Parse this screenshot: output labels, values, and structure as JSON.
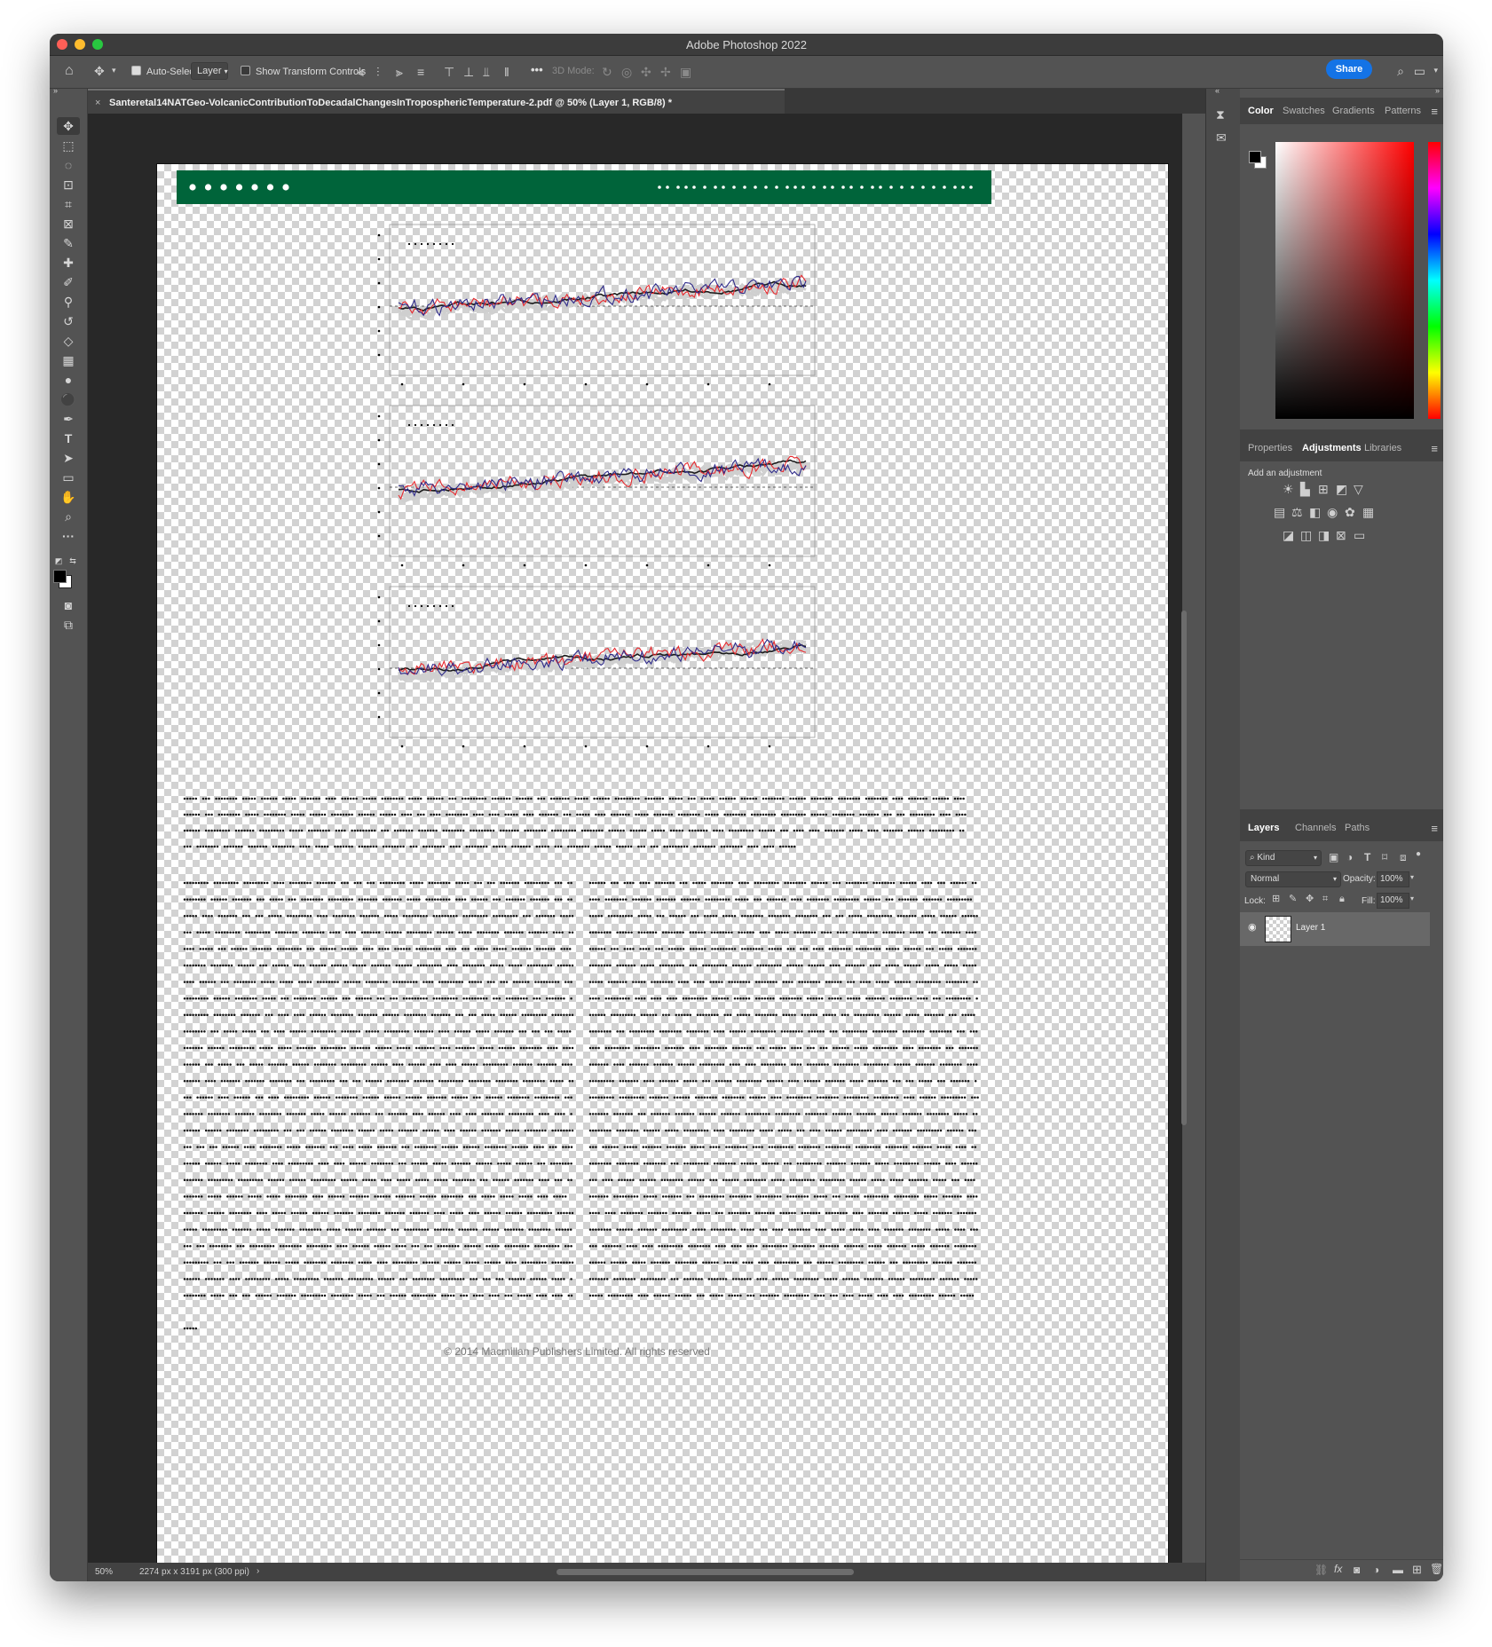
{
  "window": {
    "title": "Adobe Photoshop 2022"
  },
  "options_bar": {
    "auto_select_label": "Auto-Select:",
    "auto_select_value": "Layer",
    "show_transform_label": "Show Transform Controls",
    "mode_3d_label": "3D Mode:",
    "more_label": "•••",
    "share_label": "Share"
  },
  "document": {
    "tab_title": "Santeretal14NATGeo-VolcanicContributionToDecadalChangesInTroposphericTemperature-2.pdf @ 50% (Layer 1, RGB/8) *",
    "copyright": "© 2014 Macmillan Publishers Limited. All rights reserved"
  },
  "chart_data": [
    {
      "type": "line",
      "title": "",
      "grid": false,
      "series": [
        {
          "name": "",
          "color": "#1a1a1a"
        },
        {
          "name": "",
          "color": "#e8292e"
        },
        {
          "name": "",
          "color": "#2e2a8a"
        }
      ]
    },
    {
      "type": "line",
      "title": "",
      "grid": false,
      "series": [
        {
          "name": "",
          "color": "#1a1a1a"
        },
        {
          "name": "",
          "color": "#e8292e"
        },
        {
          "name": "",
          "color": "#2e2a8a"
        }
      ]
    },
    {
      "type": "line",
      "title": "",
      "grid": false,
      "series": [
        {
          "name": "",
          "color": "#1a1a1a"
        },
        {
          "name": "",
          "color": "#e8292e"
        },
        {
          "name": "",
          "color": "#2e2a8a"
        }
      ]
    }
  ],
  "right_panels": {
    "color_tabs": [
      "Color",
      "Swatches",
      "Gradients",
      "Patterns"
    ],
    "adjust_tabs": [
      "Properties",
      "Adjustments",
      "Libraries"
    ],
    "add_adjustment_label": "Add an adjustment",
    "layers_tabs": [
      "Layers",
      "Channels",
      "Paths"
    ],
    "kind_label": "Kind",
    "blend_mode": "Normal",
    "opacity_label": "Opacity:",
    "opacity_value": "100%",
    "lock_label": "Lock:",
    "fill_label": "Fill:",
    "fill_value": "100%",
    "layer_name": "Layer 1"
  },
  "status": {
    "zoom": "50%",
    "doc_info": "2274 px x 3191 px (300 ppi)"
  },
  "colors": {
    "accent": "#1473e6",
    "banner": "#00643a",
    "series_black": "#1a1a1a",
    "series_red": "#e8292e",
    "series_navy": "#2e2a8a"
  }
}
